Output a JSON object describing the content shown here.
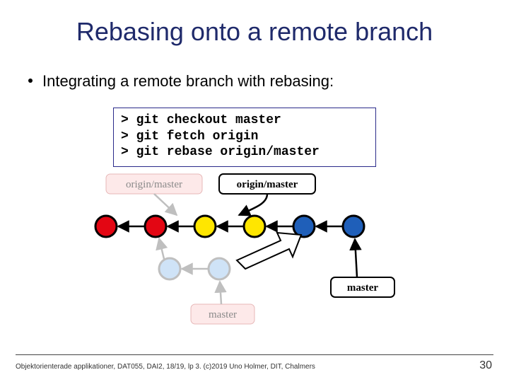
{
  "title": "Rebasing onto a remote branch",
  "bullet": "Integrating a remote branch with rebasing:",
  "code": {
    "line1": "> git checkout master",
    "line2": "> git fetch origin",
    "line3": "> git rebase origin/master"
  },
  "labels": {
    "origin_master_old": "origin/master",
    "origin_master_new": "origin/master",
    "master_old": "master",
    "master_new": "master"
  },
  "footer": "Objektorienterade applikationer, DAT055, DAI2, 18/19, lp 3. (c)2019 Uno Holmer, DIT, Chalmers",
  "page": "30",
  "chart_data": {
    "type": "diagram",
    "description": "Git commit graph showing rebase onto remote branch",
    "top_row_commits": [
      {
        "id": "c1",
        "color": "red"
      },
      {
        "id": "c2",
        "color": "red"
      },
      {
        "id": "c3",
        "color": "yellow"
      },
      {
        "id": "c4",
        "color": "yellow"
      },
      {
        "id": "c5",
        "color": "blue"
      },
      {
        "id": "c6",
        "color": "blue"
      }
    ],
    "bottom_row_commits": [
      {
        "id": "b1",
        "color": "lightblue",
        "faded": true
      },
      {
        "id": "b2",
        "color": "lightblue",
        "faded": true
      }
    ],
    "pointers": {
      "origin_master_old": {
        "points_to": "c3",
        "faded": true
      },
      "origin_master_new": {
        "points_to": "c4"
      },
      "master_old": {
        "points_to": "b2",
        "faded": true
      },
      "master_new": {
        "points_to": "c6"
      }
    },
    "edges": [
      [
        "c2",
        "c1"
      ],
      [
        "c3",
        "c2"
      ],
      [
        "c4",
        "c3"
      ],
      [
        "c5",
        "c4"
      ],
      [
        "c6",
        "c5"
      ],
      [
        "b1",
        "c2"
      ],
      [
        "b2",
        "b1"
      ]
    ],
    "move_arrow": {
      "from_near": "b2",
      "to_near": "c5",
      "style": "open-outline"
    }
  }
}
